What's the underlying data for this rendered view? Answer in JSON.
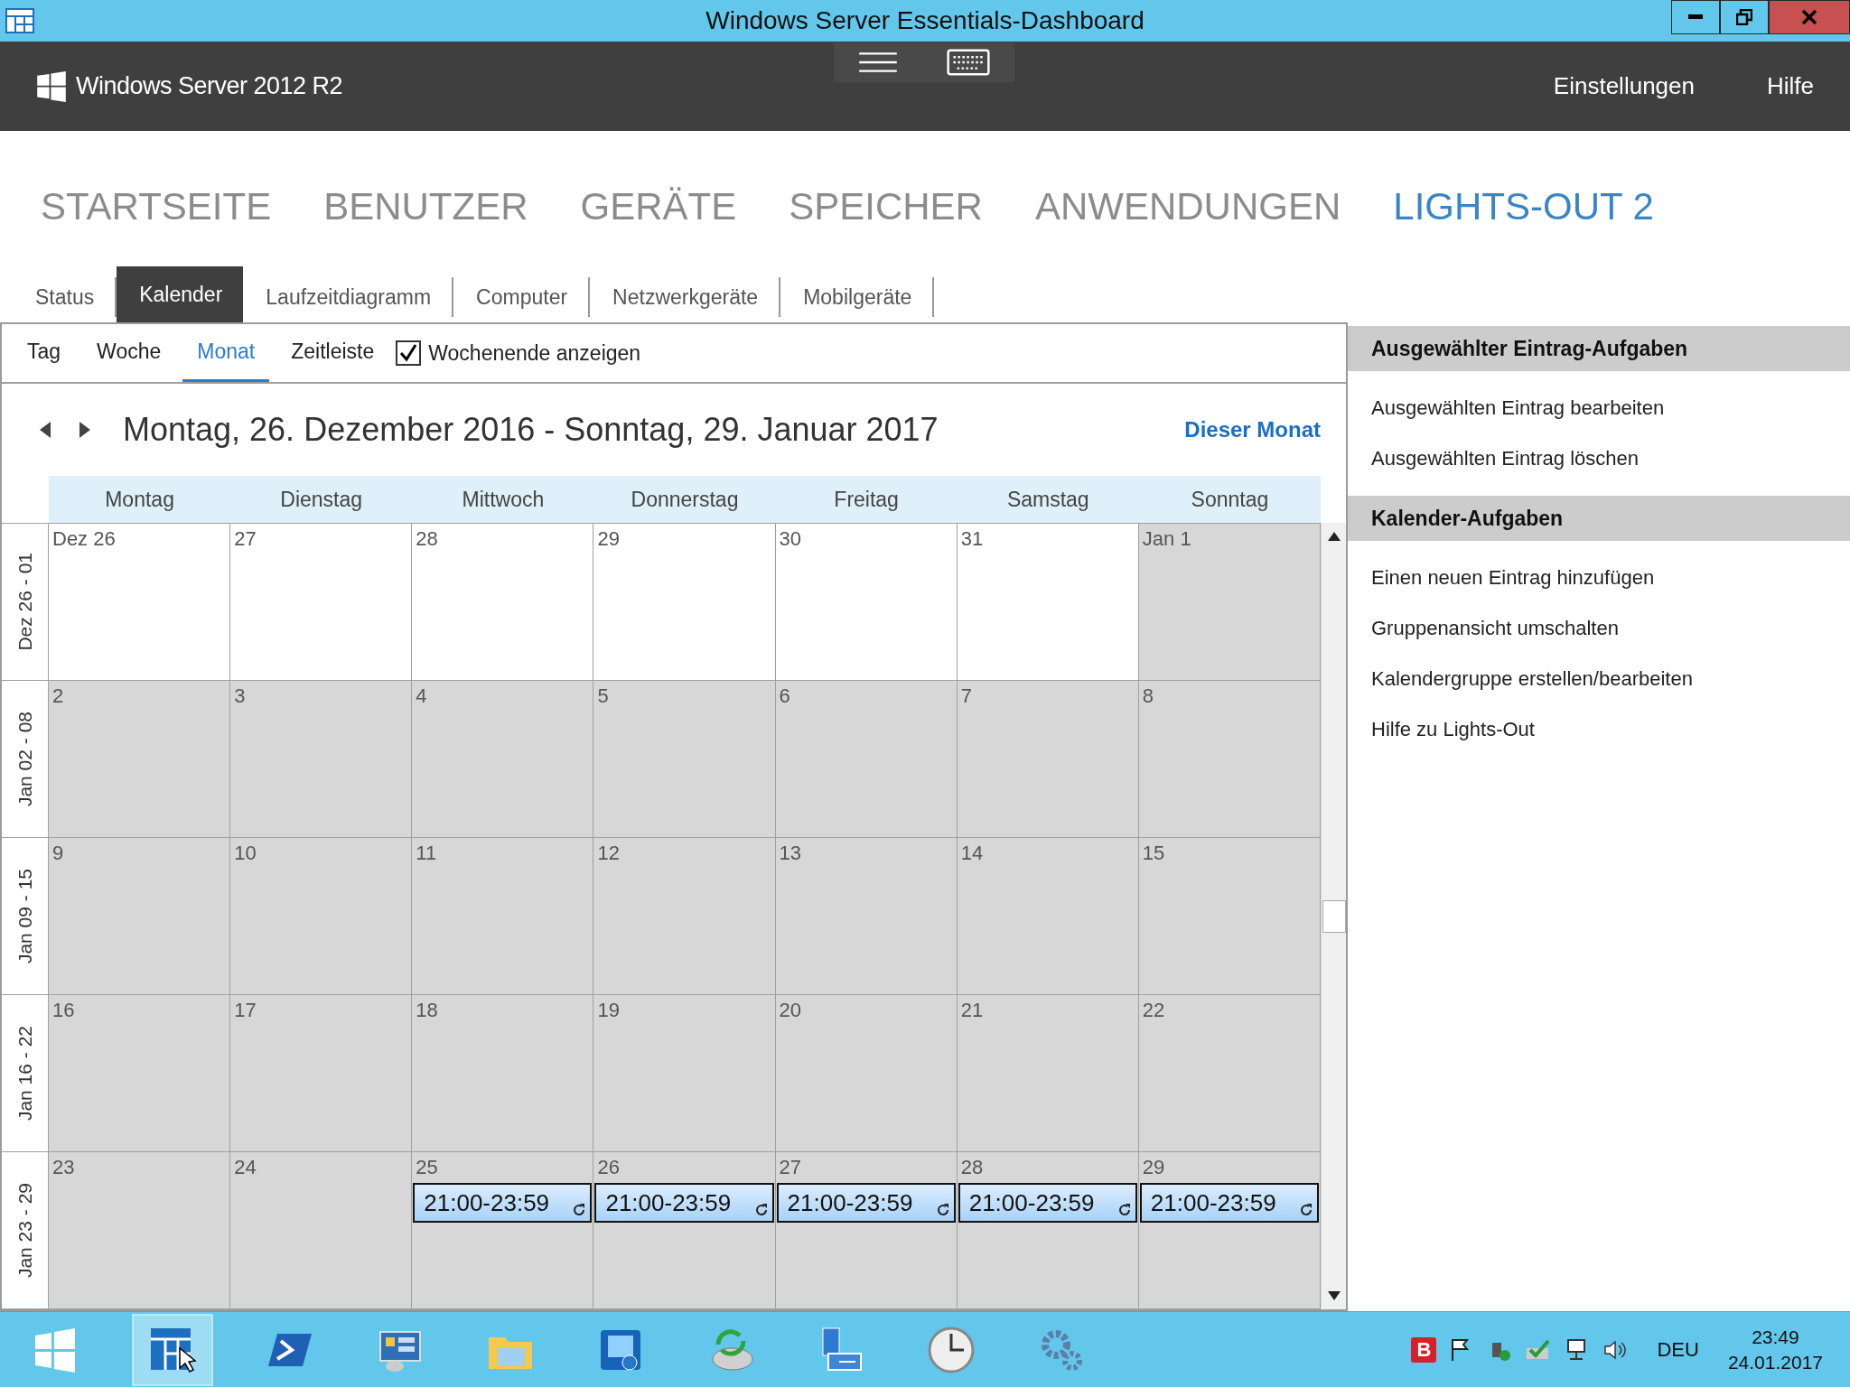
{
  "window": {
    "title": "Windows Server Essentials-Dashboard"
  },
  "header": {
    "product": "Windows Server 2012 R2",
    "links": [
      "Einstellungen",
      "Hilfe"
    ]
  },
  "main_nav": [
    {
      "label": "STARTSEITE",
      "selected": false
    },
    {
      "label": "BENUTZER",
      "selected": false
    },
    {
      "label": "GERÄTE",
      "selected": false
    },
    {
      "label": "SPEICHER",
      "selected": false
    },
    {
      "label": "ANWENDUNGEN",
      "selected": false
    },
    {
      "label": "LIGHTS-OUT 2",
      "selected": true
    }
  ],
  "sub_tabs": [
    {
      "label": "Status",
      "selected": false
    },
    {
      "label": "Kalender",
      "selected": true
    },
    {
      "label": "Laufzeitdiagramm",
      "selected": false
    },
    {
      "label": "Computer",
      "selected": false
    },
    {
      "label": "Netzwerkgeräte",
      "selected": false
    },
    {
      "label": "Mobilgeräte",
      "selected": false
    }
  ],
  "views": [
    {
      "label": "Tag",
      "selected": false
    },
    {
      "label": "Woche",
      "selected": false
    },
    {
      "label": "Monat",
      "selected": true
    },
    {
      "label": "Zeitleiste",
      "selected": false
    }
  ],
  "weekend_checkbox": {
    "label": "Wochenende anzeigen",
    "checked": true
  },
  "date_range": "Montag, 26. Dezember 2016 - Sonntag, 29. Januar 2017",
  "this_month_link": "Dieser Monat",
  "weekdays": [
    "Montag",
    "Dienstag",
    "Mittwoch",
    "Donnerstag",
    "Freitag",
    "Samstag",
    "Sonntag"
  ],
  "weeks": [
    {
      "label": "Dez 26 - 01",
      "days": [
        {
          "date": "Dez 26",
          "shaded": false
        },
        {
          "date": "27",
          "shaded": false
        },
        {
          "date": "28",
          "shaded": false
        },
        {
          "date": "29",
          "shaded": false
        },
        {
          "date": "30",
          "shaded": false
        },
        {
          "date": "31",
          "shaded": false
        },
        {
          "date": "Jan 1",
          "shaded": true
        }
      ]
    },
    {
      "label": "Jan 02 - 08",
      "days": [
        {
          "date": "2",
          "shaded": true
        },
        {
          "date": "3",
          "shaded": true
        },
        {
          "date": "4",
          "shaded": true
        },
        {
          "date": "5",
          "shaded": true
        },
        {
          "date": "6",
          "shaded": true
        },
        {
          "date": "7",
          "shaded": true
        },
        {
          "date": "8",
          "shaded": true
        }
      ]
    },
    {
      "label": "Jan 09 - 15",
      "days": [
        {
          "date": "9",
          "shaded": true
        },
        {
          "date": "10",
          "shaded": true
        },
        {
          "date": "11",
          "shaded": true
        },
        {
          "date": "12",
          "shaded": true
        },
        {
          "date": "13",
          "shaded": true
        },
        {
          "date": "14",
          "shaded": true
        },
        {
          "date": "15",
          "shaded": true
        }
      ]
    },
    {
      "label": "Jan 16 - 22",
      "days": [
        {
          "date": "16",
          "shaded": true
        },
        {
          "date": "17",
          "shaded": true
        },
        {
          "date": "18",
          "shaded": true
        },
        {
          "date": "19",
          "shaded": true
        },
        {
          "date": "20",
          "shaded": true
        },
        {
          "date": "21",
          "shaded": true
        },
        {
          "date": "22",
          "shaded": true
        }
      ]
    },
    {
      "label": "Jan 23 - 29",
      "days": [
        {
          "date": "23",
          "shaded": true
        },
        {
          "date": "24",
          "shaded": true
        },
        {
          "date": "25",
          "shaded": true,
          "events": [
            "21:00-23:59"
          ]
        },
        {
          "date": "26",
          "shaded": true,
          "events": [
            "21:00-23:59"
          ]
        },
        {
          "date": "27",
          "shaded": true,
          "events": [
            "21:00-23:59"
          ]
        },
        {
          "date": "28",
          "shaded": true,
          "events": [
            "21:00-23:59"
          ]
        },
        {
          "date": "29",
          "shaded": true,
          "events": [
            "21:00-23:59"
          ]
        }
      ]
    }
  ],
  "task_panel": [
    {
      "heading": "Ausgewählter Eintrag-Aufgaben",
      "items": [
        "Ausgewählten Eintrag bearbeiten",
        "Ausgewählten Eintrag löschen"
      ]
    },
    {
      "heading": "Kalender-Aufgaben",
      "items": [
        "Einen neuen Eintrag hinzufügen",
        "Gruppenansicht umschalten",
        "Kalendergruppe erstellen/bearbeiten",
        "Hilfe zu Lights-Out"
      ]
    }
  ],
  "taskbar": {
    "apps": [
      {
        "kind": "start",
        "selected": false
      },
      {
        "kind": "dashboard",
        "selected": true
      },
      {
        "kind": "powershell",
        "selected": false
      },
      {
        "kind": "servermanager",
        "selected": false
      },
      {
        "kind": "explorer",
        "selected": false
      },
      {
        "kind": "chip",
        "selected": false
      },
      {
        "kind": "sync",
        "selected": false
      },
      {
        "kind": "network",
        "selected": false
      },
      {
        "kind": "clock",
        "selected": false
      },
      {
        "kind": "gear",
        "selected": false
      }
    ],
    "tray_badge": "B",
    "language": "DEU",
    "time": "23:49",
    "date": "24.01.2017"
  }
}
